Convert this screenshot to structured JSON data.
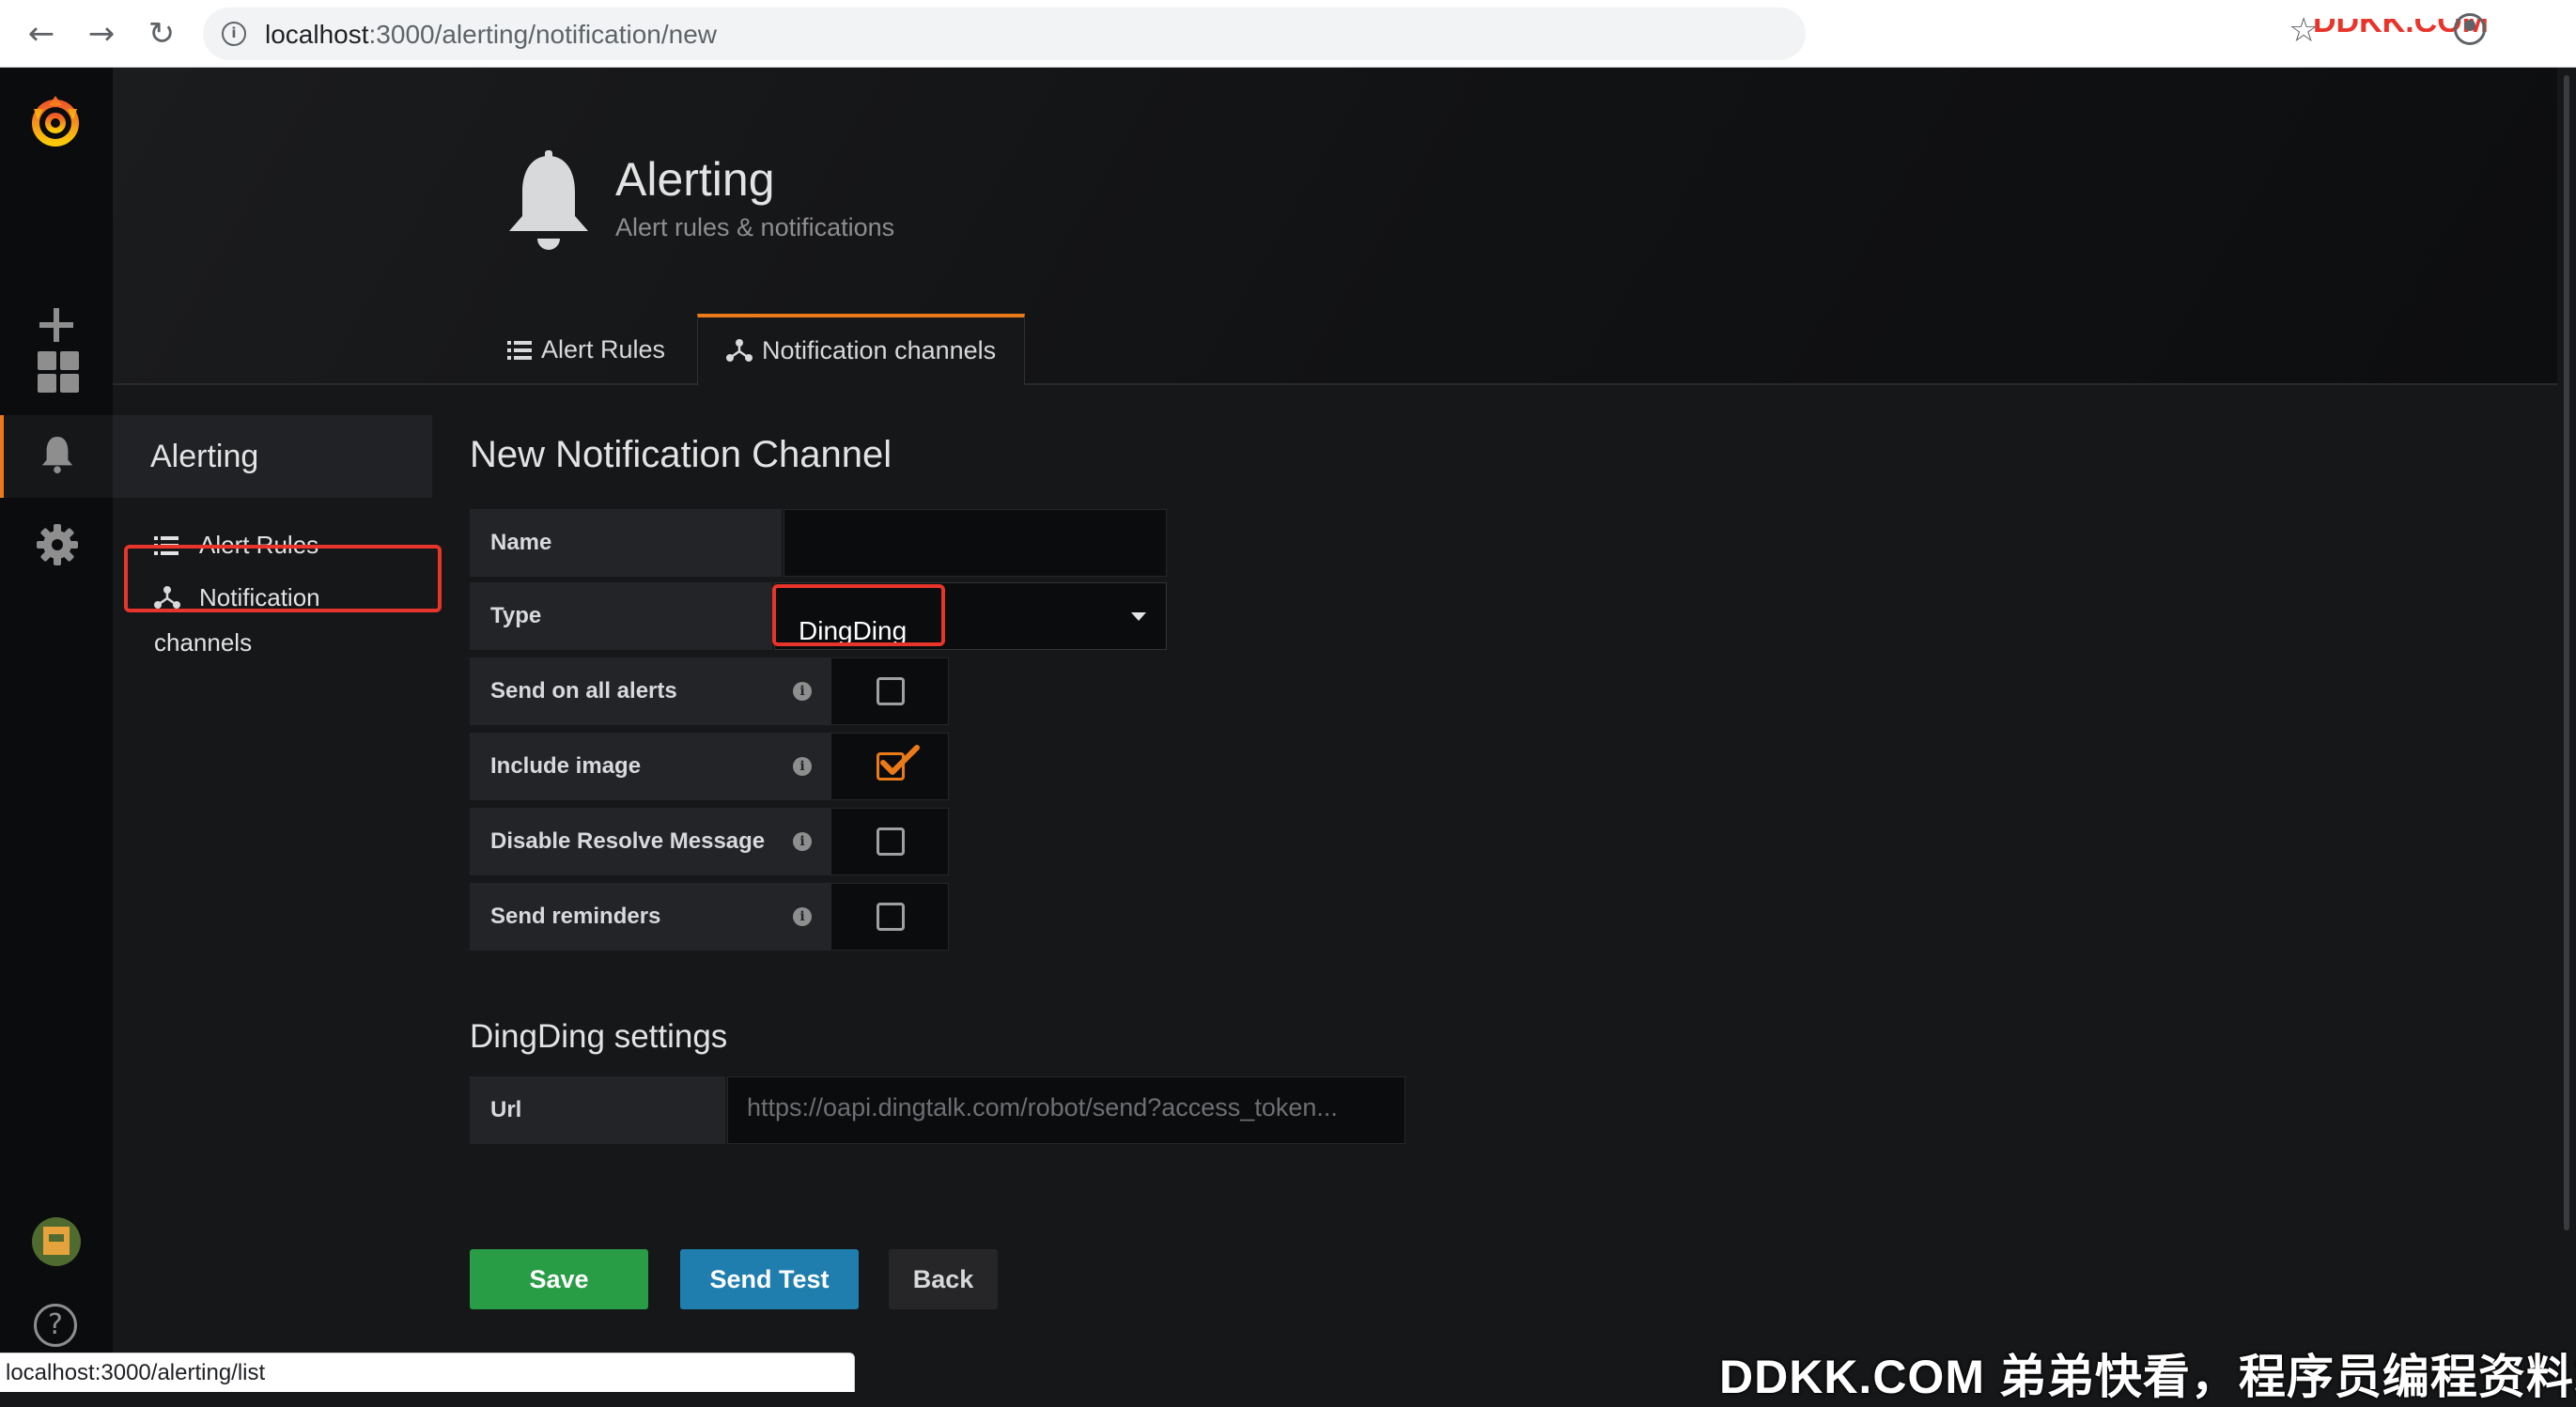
{
  "browser": {
    "url_host": "localhost",
    "url_path": ":3000/alerting/notification/new",
    "back_glyph": "←",
    "forward_glyph": "→",
    "reload_glyph": "↻",
    "info_glyph": "i",
    "star_glyph": "☆"
  },
  "sidemenu": {
    "help_glyph": "?"
  },
  "header": {
    "title": "Alerting",
    "subtitle": "Alert rules & notifications",
    "tabs": [
      {
        "label": "Alert Rules"
      },
      {
        "label": "Notification channels",
        "active": true
      }
    ]
  },
  "subnav": {
    "title": "Alerting",
    "items": [
      {
        "label": "Alert Rules"
      },
      {
        "label": "Notification channels",
        "active": true
      }
    ]
  },
  "form": {
    "title": "New Notification Channel",
    "name_label": "Name",
    "name_value": "",
    "type_label": "Type",
    "type_value": "DingDing",
    "info_glyph": "i",
    "options": [
      {
        "label": "Send on all alerts",
        "checked": false
      },
      {
        "label": "Include image",
        "checked": true
      },
      {
        "label": "Disable Resolve Message",
        "checked": false
      },
      {
        "label": "Send reminders",
        "checked": false
      }
    ],
    "settings_title": "DingDing settings",
    "url_label": "Url",
    "url_placeholder": "https://oapi.dingtalk.com/robot/send?access_token..."
  },
  "buttons": {
    "save": "Save",
    "send_test": "Send Test",
    "back": "Back"
  },
  "status_bar": "localhost:3000/alerting/list",
  "watermark": "DDKK.COM 弟弟快看，程序员编程资料站",
  "colors": {
    "accent": "#eb7b18",
    "save": "#299c46",
    "send_test": "#1f7eae",
    "highlight": "#e8342a"
  }
}
